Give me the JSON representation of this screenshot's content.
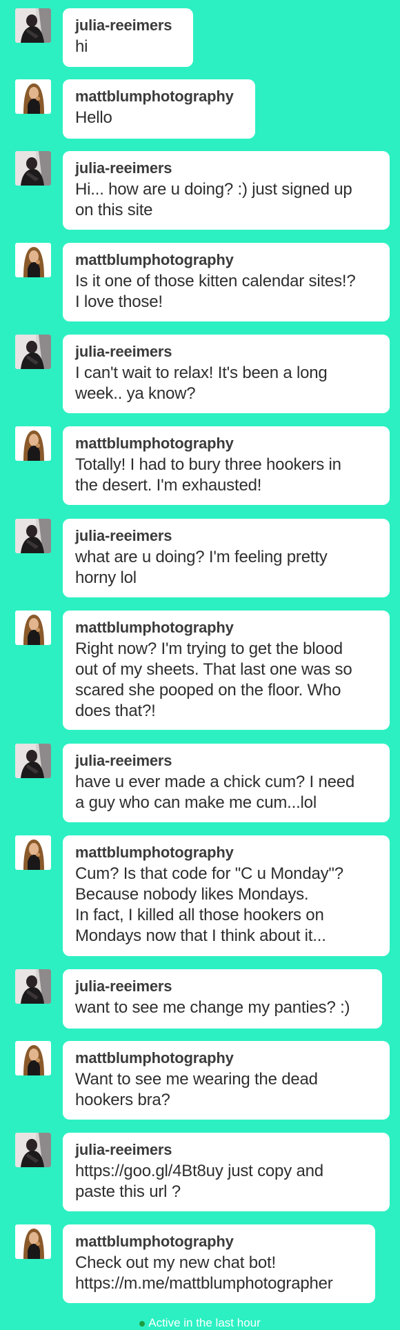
{
  "messages": [
    {
      "sender": "julia-reeimers",
      "text": "hi"
    },
    {
      "sender": "mattblumphotography",
      "text": "Hello"
    },
    {
      "sender": "julia-reeimers",
      "text": "Hi... how are u doing? :) just signed up\non this site"
    },
    {
      "sender": "mattblumphotography",
      "text": "Is it one of those kitten calendar sites!?\nI love those!"
    },
    {
      "sender": "julia-reeimers",
      "text": "I can't wait to relax!  It's been a long\nweek.. ya know?"
    },
    {
      "sender": "mattblumphotography",
      "text": "Totally! I had to bury three hookers in\nthe desert. I'm exhausted!"
    },
    {
      "sender": "julia-reeimers",
      "text": "what are u doing?  I'm feeling pretty\nhorny lol"
    },
    {
      "sender": "mattblumphotography",
      "text": "Right now? I'm trying to get the blood\nout of my sheets. That last one was so\nscared she pooped on the floor. Who\ndoes that?!"
    },
    {
      "sender": "julia-reeimers",
      "text": "have u ever made a chick cum?  I need\na guy who can make me cum...lol"
    },
    {
      "sender": "mattblumphotography",
      "text": "Cum? Is that code for \"C u Monday\"?\nBecause nobody likes Mondays.\nIn fact, I killed all those hookers on\nMondays now that I think about it..."
    },
    {
      "sender": "julia-reeimers",
      "text": "want to see me change my panties?  :)"
    },
    {
      "sender": "mattblumphotography",
      "text": "Want to see me wearing the dead\nhookers bra?"
    },
    {
      "sender": "julia-reeimers",
      "text": "https://goo.gl/4Bt8uy just copy and\npaste this url ?"
    },
    {
      "sender": "mattblumphotography",
      "text": "Check out my new chat bot!\nhttps://m.me/mattblumphotographer"
    }
  ],
  "status_text": "Active in the last hour",
  "colors": {
    "background": "#2cf0c2",
    "bubble": "#ffffff",
    "username": "#3b3b3b",
    "message_text": "#2e2e2e",
    "status_dot": "#1c9e3e"
  }
}
